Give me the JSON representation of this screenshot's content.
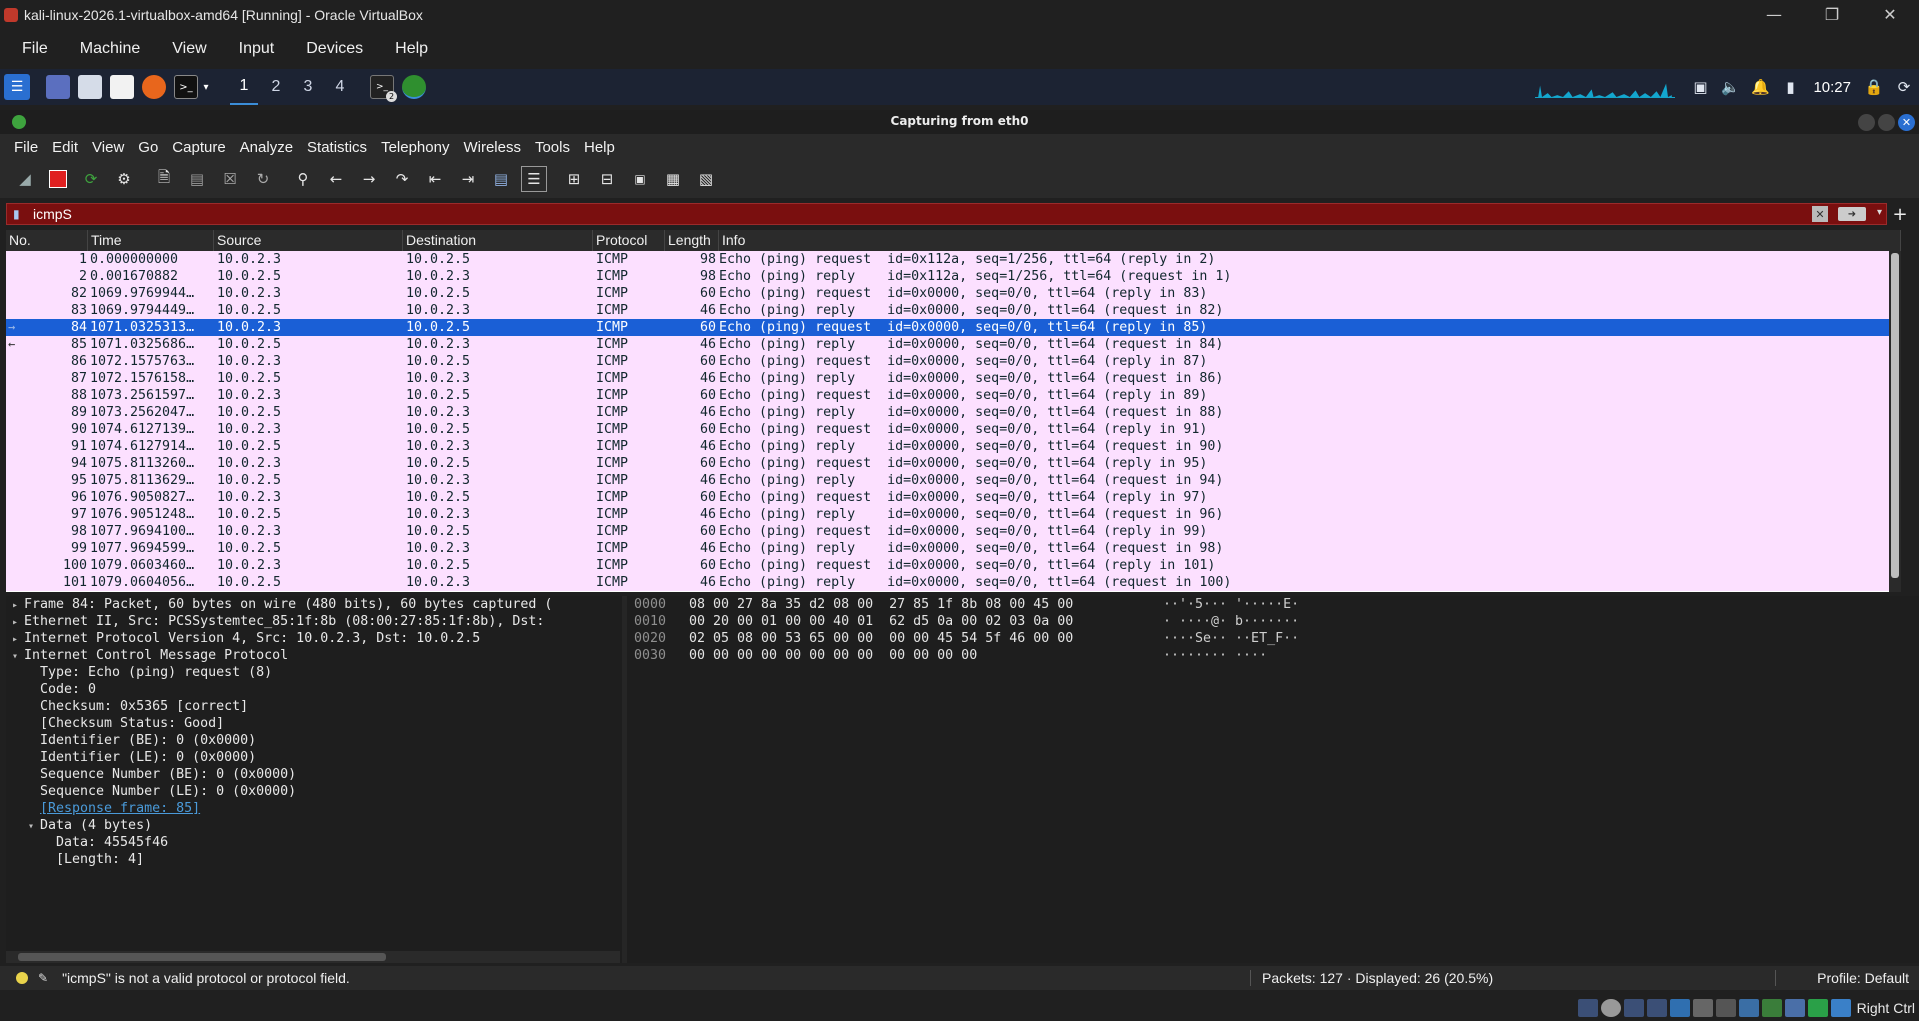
{
  "vbox": {
    "title": "kali-linux-2026.1-virtualbox-amd64 [Running] - Oracle VirtualBox",
    "menu": [
      "File",
      "Machine",
      "View",
      "Input",
      "Devices",
      "Help"
    ],
    "host_key": "Right Ctrl"
  },
  "panel": {
    "workspaces": [
      "1",
      "2",
      "3",
      "4"
    ],
    "active_workspace": "1",
    "time": "10:27",
    "terminal_badge": "2"
  },
  "wireshark": {
    "title": "Capturing from eth0",
    "menu": [
      "File",
      "Edit",
      "View",
      "Go",
      "Capture",
      "Analyze",
      "Statistics",
      "Telephony",
      "Wireless",
      "Tools",
      "Help"
    ],
    "filter": {
      "value": "icmpS",
      "invalid": true,
      "color": "#7a0f0f"
    },
    "columns": [
      "No.",
      "Time",
      "Source",
      "Destination",
      "Protocol",
      "Length",
      "Info"
    ],
    "packets": [
      {
        "no": "1",
        "time": "0.000000000",
        "src": "10.0.2.3",
        "dst": "10.0.2.5",
        "proto": "ICMP",
        "len": "98",
        "info": "Echo (ping) request  id=0x112a, seq=1/256, ttl=64 (reply in 2)"
      },
      {
        "no": "2",
        "time": "0.001670882",
        "src": "10.0.2.5",
        "dst": "10.0.2.3",
        "proto": "ICMP",
        "len": "98",
        "info": "Echo (ping) reply    id=0x112a, seq=1/256, ttl=64 (request in 1)"
      },
      {
        "no": "82",
        "time": "1069.9769944…",
        "src": "10.0.2.3",
        "dst": "10.0.2.5",
        "proto": "ICMP",
        "len": "60",
        "info": "Echo (ping) request  id=0x0000, seq=0/0, ttl=64 (reply in 83)"
      },
      {
        "no": "83",
        "time": "1069.9794449…",
        "src": "10.0.2.5",
        "dst": "10.0.2.3",
        "proto": "ICMP",
        "len": "46",
        "info": "Echo (ping) reply    id=0x0000, seq=0/0, ttl=64 (request in 82)"
      },
      {
        "no": "84",
        "time": "1071.0325313…",
        "src": "10.0.2.3",
        "dst": "10.0.2.5",
        "proto": "ICMP",
        "len": "60",
        "info": "Echo (ping) request  id=0x0000, seq=0/0, ttl=64 (reply in 85)",
        "selected": true
      },
      {
        "no": "85",
        "time": "1071.0325686…",
        "src": "10.0.2.5",
        "dst": "10.0.2.3",
        "proto": "ICMP",
        "len": "46",
        "info": "Echo (ping) reply    id=0x0000, seq=0/0, ttl=64 (request in 84)"
      },
      {
        "no": "86",
        "time": "1072.1575763…",
        "src": "10.0.2.3",
        "dst": "10.0.2.5",
        "proto": "ICMP",
        "len": "60",
        "info": "Echo (ping) request  id=0x0000, seq=0/0, ttl=64 (reply in 87)"
      },
      {
        "no": "87",
        "time": "1072.1576158…",
        "src": "10.0.2.5",
        "dst": "10.0.2.3",
        "proto": "ICMP",
        "len": "46",
        "info": "Echo (ping) reply    id=0x0000, seq=0/0, ttl=64 (request in 86)"
      },
      {
        "no": "88",
        "time": "1073.2561597…",
        "src": "10.0.2.3",
        "dst": "10.0.2.5",
        "proto": "ICMP",
        "len": "60",
        "info": "Echo (ping) request  id=0x0000, seq=0/0, ttl=64 (reply in 89)"
      },
      {
        "no": "89",
        "time": "1073.2562047…",
        "src": "10.0.2.5",
        "dst": "10.0.2.3",
        "proto": "ICMP",
        "len": "46",
        "info": "Echo (ping) reply    id=0x0000, seq=0/0, ttl=64 (request in 88)"
      },
      {
        "no": "90",
        "time": "1074.6127139…",
        "src": "10.0.2.3",
        "dst": "10.0.2.5",
        "proto": "ICMP",
        "len": "60",
        "info": "Echo (ping) request  id=0x0000, seq=0/0, ttl=64 (reply in 91)"
      },
      {
        "no": "91",
        "time": "1074.6127914…",
        "src": "10.0.2.5",
        "dst": "10.0.2.3",
        "proto": "ICMP",
        "len": "46",
        "info": "Echo (ping) reply    id=0x0000, seq=0/0, ttl=64 (request in 90)"
      },
      {
        "no": "94",
        "time": "1075.8113260…",
        "src": "10.0.2.3",
        "dst": "10.0.2.5",
        "proto": "ICMP",
        "len": "60",
        "info": "Echo (ping) request  id=0x0000, seq=0/0, ttl=64 (reply in 95)"
      },
      {
        "no": "95",
        "time": "1075.8113629…",
        "src": "10.0.2.5",
        "dst": "10.0.2.3",
        "proto": "ICMP",
        "len": "46",
        "info": "Echo (ping) reply    id=0x0000, seq=0/0, ttl=64 (request in 94)"
      },
      {
        "no": "96",
        "time": "1076.9050827…",
        "src": "10.0.2.3",
        "dst": "10.0.2.5",
        "proto": "ICMP",
        "len": "60",
        "info": "Echo (ping) request  id=0x0000, seq=0/0, ttl=64 (reply in 97)"
      },
      {
        "no": "97",
        "time": "1076.9051248…",
        "src": "10.0.2.5",
        "dst": "10.0.2.3",
        "proto": "ICMP",
        "len": "46",
        "info": "Echo (ping) reply    id=0x0000, seq=0/0, ttl=64 (request in 96)"
      },
      {
        "no": "98",
        "time": "1077.9694100…",
        "src": "10.0.2.3",
        "dst": "10.0.2.5",
        "proto": "ICMP",
        "len": "60",
        "info": "Echo (ping) request  id=0x0000, seq=0/0, ttl=64 (reply in 99)"
      },
      {
        "no": "99",
        "time": "1077.9694599…",
        "src": "10.0.2.5",
        "dst": "10.0.2.3",
        "proto": "ICMP",
        "len": "46",
        "info": "Echo (ping) reply    id=0x0000, seq=0/0, ttl=64 (request in 98)"
      },
      {
        "no": "100",
        "time": "1079.0603460…",
        "src": "10.0.2.3",
        "dst": "10.0.2.5",
        "proto": "ICMP",
        "len": "60",
        "info": "Echo (ping) request  id=0x0000, seq=0/0, ttl=64 (reply in 101)"
      },
      {
        "no": "101",
        "time": "1079.0604056…",
        "src": "10.0.2.5",
        "dst": "10.0.2.3",
        "proto": "ICMP",
        "len": "46",
        "info": "Echo (ping) reply    id=0x0000, seq=0/0, ttl=64 (request in 100)"
      }
    ],
    "details": [
      {
        "indent": 0,
        "arrow": "collapsed",
        "text": "Frame 84: Packet, 60 bytes on wire (480 bits), 60 bytes captured ("
      },
      {
        "indent": 0,
        "arrow": "collapsed",
        "text": "Ethernet II, Src: PCSSystemtec_85:1f:8b (08:00:27:85:1f:8b), Dst:"
      },
      {
        "indent": 0,
        "arrow": "collapsed",
        "text": "Internet Protocol Version 4, Src: 10.0.2.3, Dst: 10.0.2.5"
      },
      {
        "indent": 0,
        "arrow": "expanded",
        "text": "Internet Control Message Protocol"
      },
      {
        "indent": 1,
        "arrow": "none",
        "text": "Type: Echo (ping) request (8)"
      },
      {
        "indent": 1,
        "arrow": "none",
        "text": "Code: 0"
      },
      {
        "indent": 1,
        "arrow": "none",
        "text": "Checksum: 0x5365 [correct]"
      },
      {
        "indent": 1,
        "arrow": "none",
        "text": "[Checksum Status: Good]"
      },
      {
        "indent": 1,
        "arrow": "none",
        "text": "Identifier (BE): 0 (0x0000)"
      },
      {
        "indent": 1,
        "arrow": "none",
        "text": "Identifier (LE): 0 (0x0000)"
      },
      {
        "indent": 1,
        "arrow": "none",
        "text": "Sequence Number (BE): 0 (0x0000)"
      },
      {
        "indent": 1,
        "arrow": "none",
        "text": "Sequence Number (LE): 0 (0x0000)"
      },
      {
        "indent": 1,
        "arrow": "none",
        "text": "[Response frame: 85]",
        "link": true
      },
      {
        "indent": 1,
        "arrow": "expanded",
        "text": "Data (4 bytes)"
      },
      {
        "indent": 2,
        "arrow": "none",
        "text": "Data: 45545f46"
      },
      {
        "indent": 2,
        "arrow": "none",
        "text": "[Length: 4]"
      }
    ],
    "bytes": [
      {
        "offset": "0000",
        "hex": "08 00 27 8a 35 d2 08 00  27 85 1f 8b 08 00 45 00",
        "ascii": "··'·5··· '·····E·"
      },
      {
        "offset": "0010",
        "hex": "00 20 00 01 00 00 40 01  62 d5 0a 00 02 03 0a 00",
        "ascii": "· ····@· b·······"
      },
      {
        "offset": "0020",
        "hex": "02 05 08 00 53 65 00 00  00 00 45 54 5f 46 00 00",
        "ascii": "····Se·· ··ET_F··"
      },
      {
        "offset": "0030",
        "hex": "00 00 00 00 00 00 00 00  00 00 00 00",
        "ascii": "········ ····"
      }
    ],
    "status": {
      "message": "\"icmpS\" is not a valid protocol or protocol field.",
      "packets": "Packets: 127 · Displayed: 26 (20.5%)",
      "profile": "Profile: Default"
    }
  }
}
